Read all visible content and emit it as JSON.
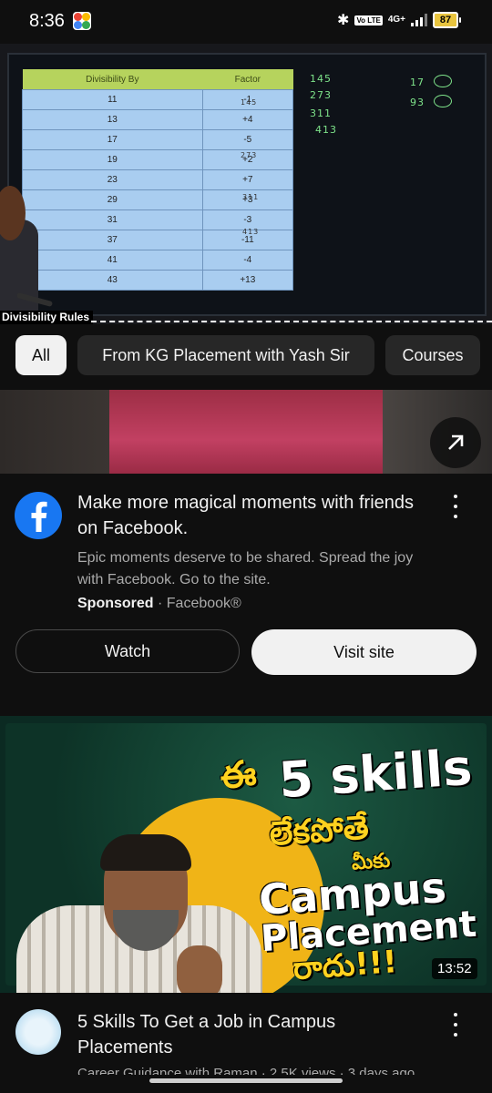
{
  "status_bar": {
    "time": "8:36",
    "volte": "Vo LTE",
    "network": "4G+",
    "battery": "87"
  },
  "video_player": {
    "caption": "Divisibility Rules",
    "table": {
      "headers": [
        "Divisibility By",
        "Factor"
      ],
      "rows": [
        {
          "divisor": "11",
          "factor": "-1"
        },
        {
          "divisor": "13",
          "factor": "+4"
        },
        {
          "divisor": "17",
          "factor": "-5"
        },
        {
          "divisor": "19",
          "factor": "+2"
        },
        {
          "divisor": "23",
          "factor": "+7"
        },
        {
          "divisor": "29",
          "factor": "+3"
        },
        {
          "divisor": "31",
          "factor": "-3"
        },
        {
          "divisor": "37",
          "factor": "-11"
        },
        {
          "divisor": "41",
          "factor": "-4"
        },
        {
          "divisor": "43",
          "factor": "+13"
        }
      ]
    },
    "handwriting": {
      "n1": "145",
      "n2": "273",
      "n3": "311",
      "n4": "413",
      "r1": "17",
      "r2": "93",
      "t1": "145",
      "t2": "273",
      "t3": "311",
      "t4": "413"
    }
  },
  "chips": [
    {
      "label": "All"
    },
    {
      "label": "From KG Placement with Yash Sir"
    },
    {
      "label": "Courses"
    }
  ],
  "ad": {
    "title": "Make more magical moments with friends on Facebook.",
    "description": "Epic moments deserve to be shared. Spread the joy with Facebook. Go to the site.",
    "sponsored": "Sponsored",
    "separator": " · ",
    "advertiser": "Facebook®",
    "watch_label": "Watch",
    "visit_label": "Visit site"
  },
  "video": {
    "thumbnail_text": {
      "line1a": "ఈ",
      "line1b": "5 skills",
      "line2": "లేకపోతే",
      "line3": "మీకు",
      "line4": "Campus",
      "line5": "Placement",
      "line6": "రాదు!!!"
    },
    "duration": "13:52",
    "title": "5 Skills To Get a Job in Campus Placements",
    "subline": "Career Guidance with Raman  ·  2.5K views  ·  3 days ago"
  },
  "colors": {
    "background": "#0f0f0f",
    "facebook_blue": "#1877f2",
    "chip_bg": "#272727",
    "thumbnail_yellow": "#f0b417"
  }
}
